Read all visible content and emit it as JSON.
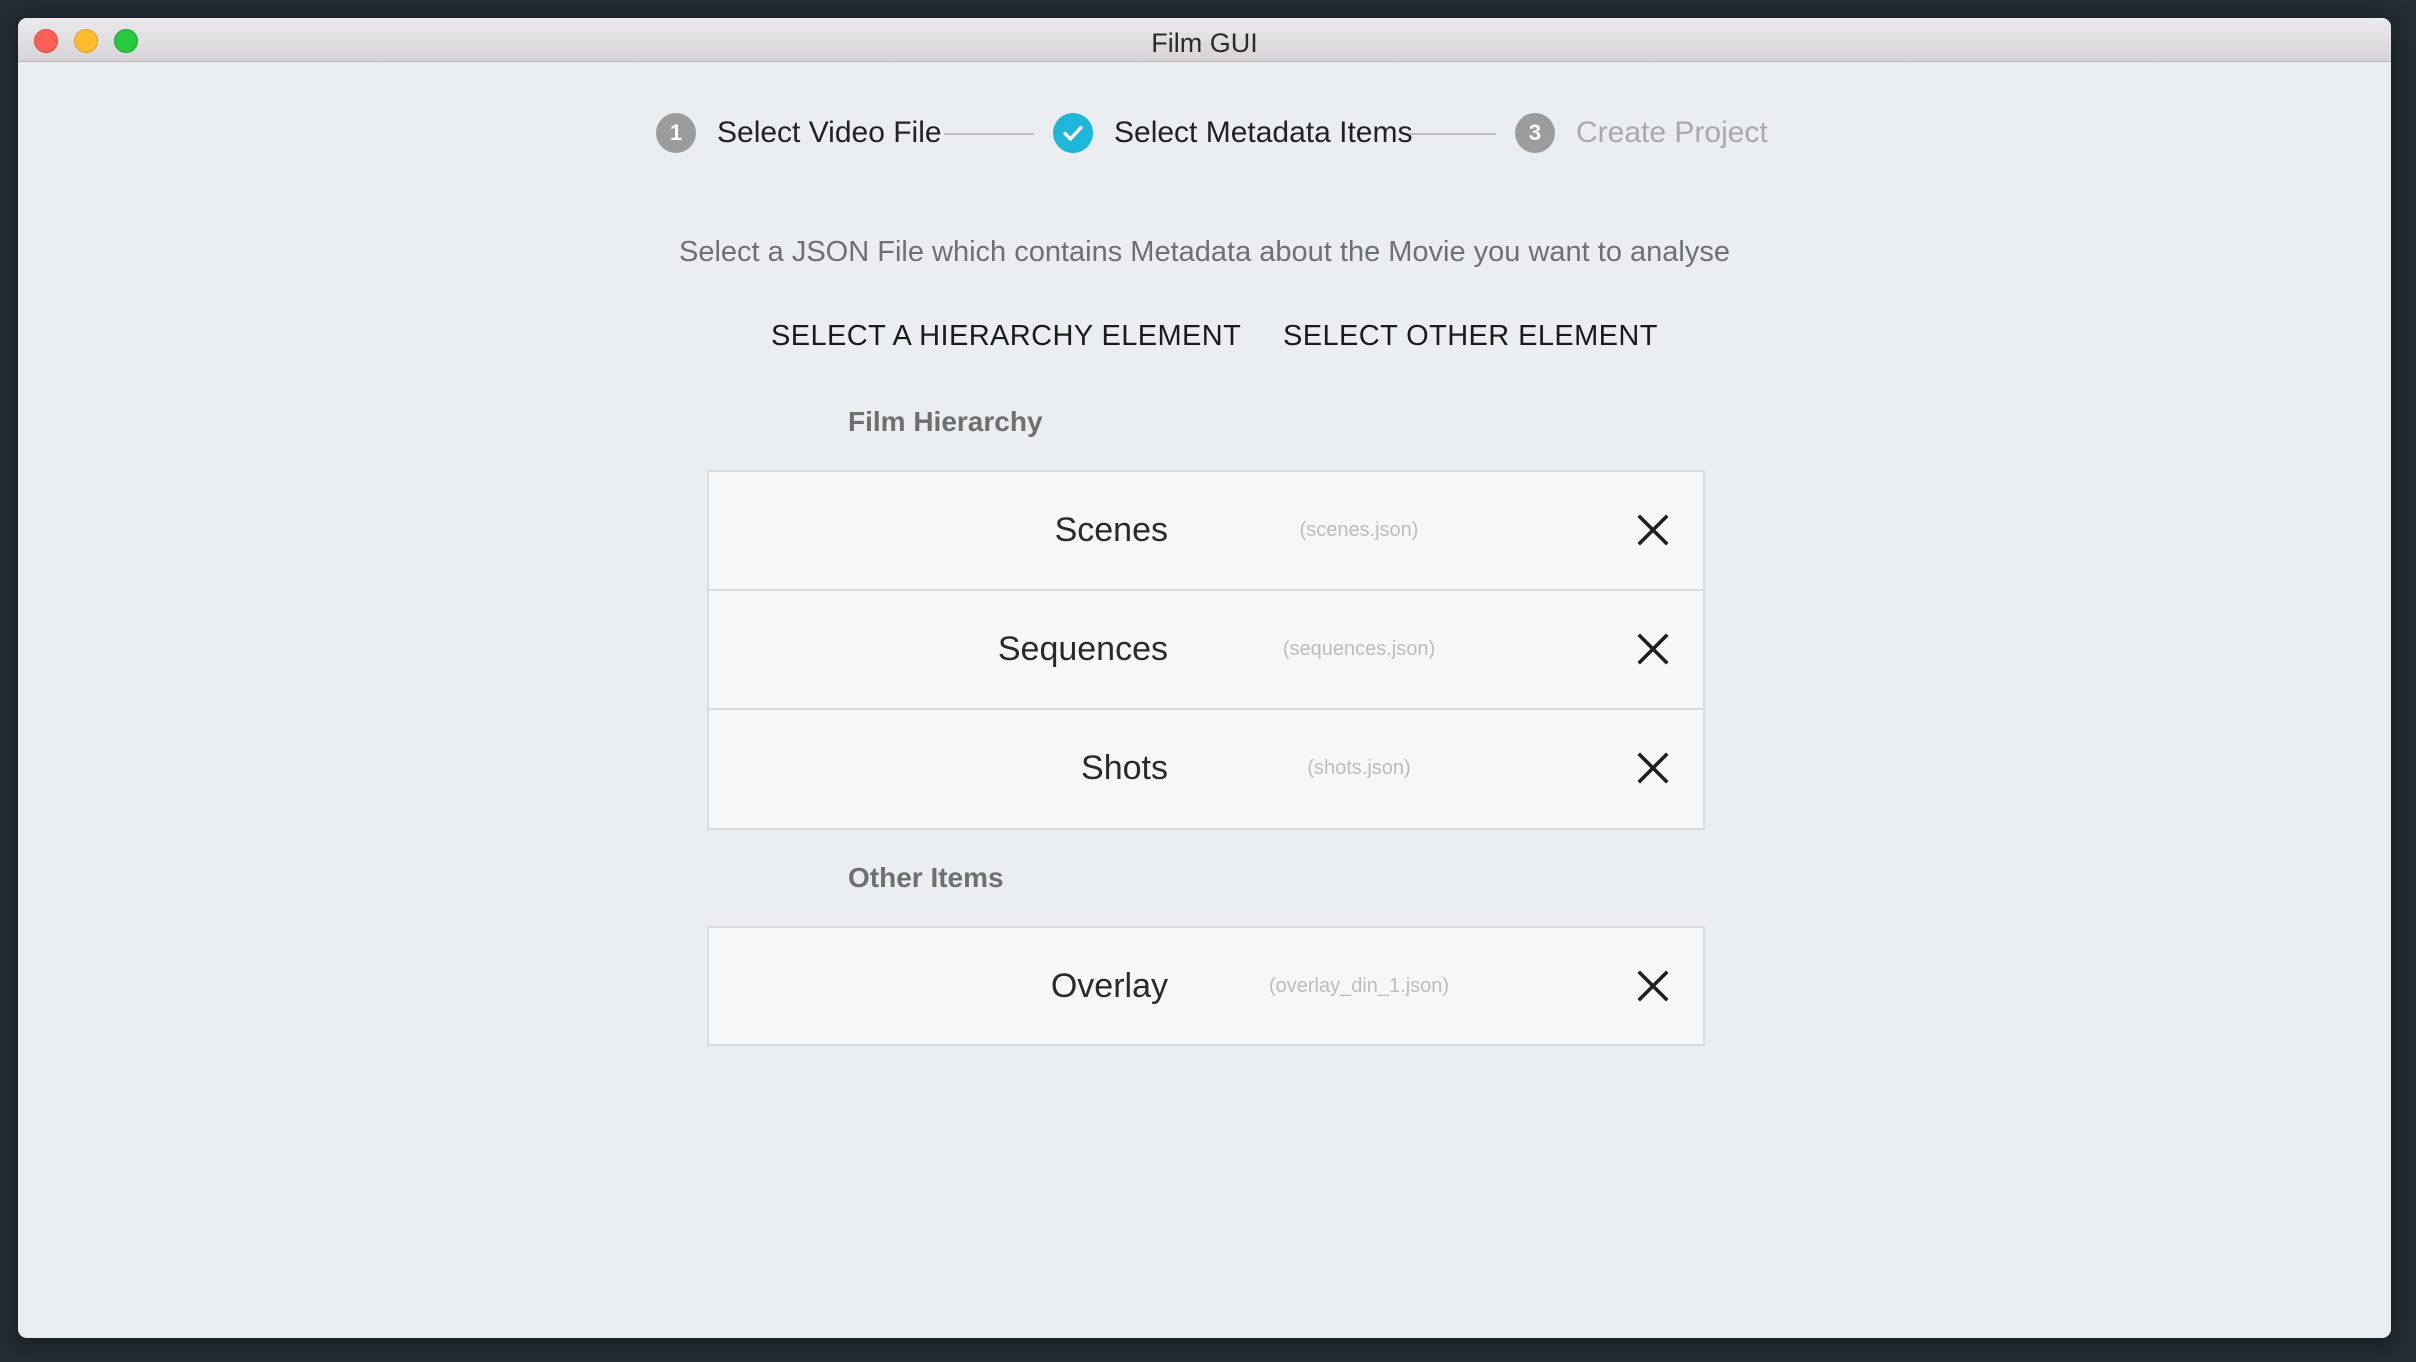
{
  "window": {
    "title": "Film GUI"
  },
  "stepper": {
    "steps": [
      {
        "number": "1",
        "label": "Select Video File",
        "state": "inactive"
      },
      {
        "number": "2",
        "label": "Select Metadata Items",
        "state": "completed"
      },
      {
        "number": "3",
        "label": "Create Project",
        "state": "disabled"
      }
    ]
  },
  "instruction": "Select a JSON File which contains Metadata about the Movie you want to analyse",
  "actions": {
    "hierarchy_button": "SELECT A HIERARCHY ELEMENT",
    "other_button": "SELECT OTHER ELEMENT"
  },
  "hierarchy": {
    "label": "Film Hierarchy",
    "items": [
      {
        "name": "Scenes",
        "file": "(scenes.json)"
      },
      {
        "name": "Sequences",
        "file": "(sequences.json)"
      },
      {
        "name": "Shots",
        "file": "(shots.json)"
      }
    ]
  },
  "other": {
    "label": "Other Items",
    "items": [
      {
        "name": "Overlay",
        "file": "(overlay_din_1.json)"
      }
    ]
  },
  "colors": {
    "accent": "#1eb6d9",
    "step_inactive": "#9c9c9c",
    "background": "#ebeef1"
  },
  "icons": {
    "step_done": "check-icon",
    "remove": "close-icon"
  }
}
